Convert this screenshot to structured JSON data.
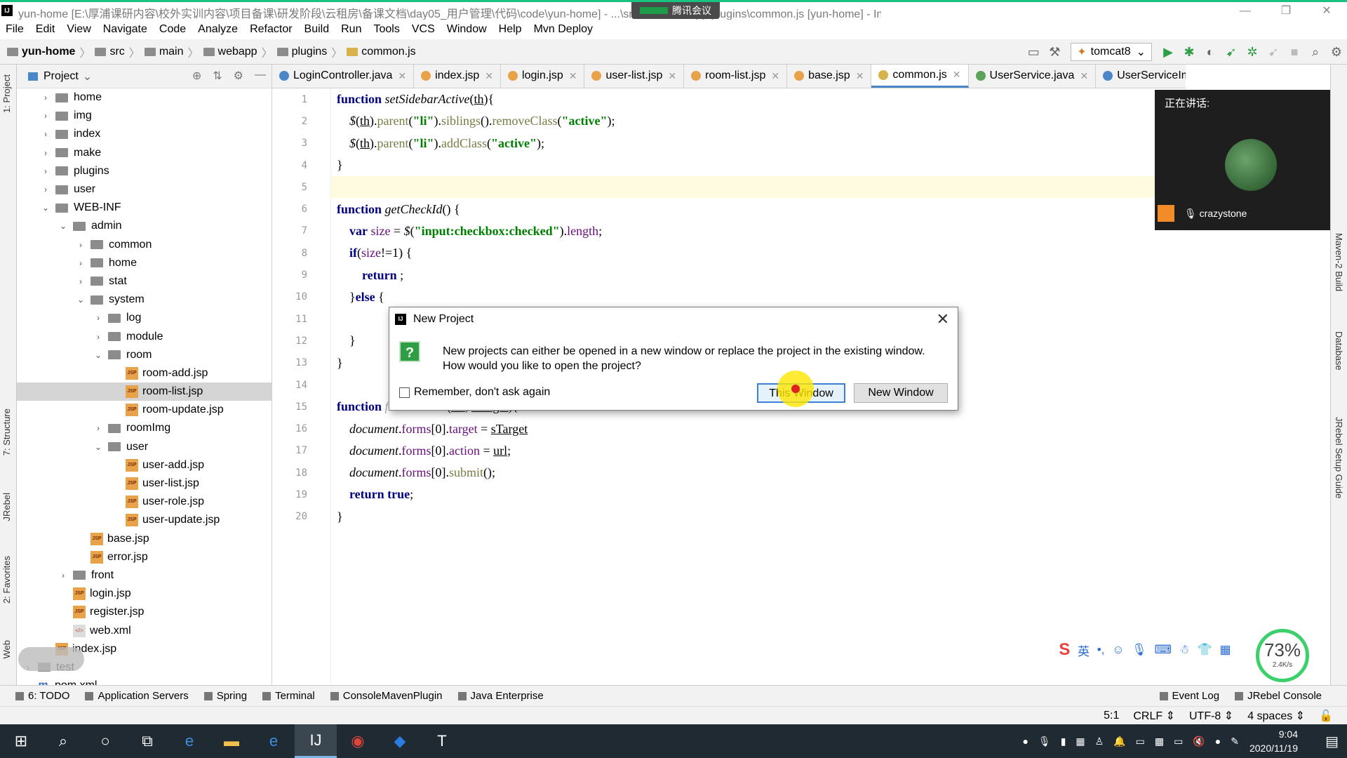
{
  "window": {
    "title": "yun-home [E:\\厚浦课研内容\\校外实训内容\\项目备课\\研发阶段\\云租房\\备课文档\\day05_用户管理\\代码\\code\\yun-home] - ...\\src\\main\\webapp\\plugins\\common.js [yun-home] - IntelliJ IDEA",
    "meeting_label": "腾讯会议"
  },
  "menu": [
    "File",
    "Edit",
    "View",
    "Navigate",
    "Code",
    "Analyze",
    "Refactor",
    "Build",
    "Run",
    "Tools",
    "VCS",
    "Window",
    "Help",
    "Mvn Deploy"
  ],
  "breadcrumb": [
    "yun-home",
    "src",
    "main",
    "webapp",
    "plugins",
    "common.js"
  ],
  "run_config": "tomcat8",
  "project_panel": {
    "title": "Project",
    "tree": [
      {
        "label": "home",
        "type": "folder",
        "depth": 1,
        "arrow": "›"
      },
      {
        "label": "img",
        "type": "folder",
        "depth": 1,
        "arrow": "›"
      },
      {
        "label": "index",
        "type": "folder",
        "depth": 1,
        "arrow": "›"
      },
      {
        "label": "make",
        "type": "folder",
        "depth": 1,
        "arrow": "›"
      },
      {
        "label": "plugins",
        "type": "folder",
        "depth": 1,
        "arrow": "›"
      },
      {
        "label": "user",
        "type": "folder",
        "depth": 1,
        "arrow": "›"
      },
      {
        "label": "WEB-INF",
        "type": "folder",
        "depth": 1,
        "arrow": "⌄"
      },
      {
        "label": "admin",
        "type": "folder",
        "depth": 2,
        "arrow": "⌄"
      },
      {
        "label": "common",
        "type": "folder",
        "depth": 3,
        "arrow": "›"
      },
      {
        "label": "home",
        "type": "folder",
        "depth": 3,
        "arrow": "›"
      },
      {
        "label": "stat",
        "type": "folder",
        "depth": 3,
        "arrow": "›"
      },
      {
        "label": "system",
        "type": "folder",
        "depth": 3,
        "arrow": "⌄"
      },
      {
        "label": "log",
        "type": "folder",
        "depth": 4,
        "arrow": "›"
      },
      {
        "label": "module",
        "type": "folder",
        "depth": 4,
        "arrow": "›"
      },
      {
        "label": "room",
        "type": "folder",
        "depth": 4,
        "arrow": "⌄"
      },
      {
        "label": "room-add.jsp",
        "type": "jsp",
        "depth": 5,
        "arrow": ""
      },
      {
        "label": "room-list.jsp",
        "type": "jsp",
        "depth": 5,
        "arrow": "",
        "selected": true
      },
      {
        "label": "room-update.jsp",
        "type": "jsp",
        "depth": 5,
        "arrow": ""
      },
      {
        "label": "roomImg",
        "type": "folder",
        "depth": 4,
        "arrow": "›"
      },
      {
        "label": "user",
        "type": "folder",
        "depth": 4,
        "arrow": "⌄"
      },
      {
        "label": "user-add.jsp",
        "type": "jsp",
        "depth": 5,
        "arrow": ""
      },
      {
        "label": "user-list.jsp",
        "type": "jsp",
        "depth": 5,
        "arrow": ""
      },
      {
        "label": "user-role.jsp",
        "type": "jsp",
        "depth": 5,
        "arrow": ""
      },
      {
        "label": "user-update.jsp",
        "type": "jsp",
        "depth": 5,
        "arrow": ""
      },
      {
        "label": "base.jsp",
        "type": "jsp",
        "depth": 3,
        "arrow": ""
      },
      {
        "label": "error.jsp",
        "type": "jsp",
        "depth": 3,
        "arrow": ""
      },
      {
        "label": "front",
        "type": "folder",
        "depth": 2,
        "arrow": "›"
      },
      {
        "label": "login.jsp",
        "type": "jsp",
        "depth": 2,
        "arrow": ""
      },
      {
        "label": "register.jsp",
        "type": "jsp",
        "depth": 2,
        "arrow": ""
      },
      {
        "label": "web.xml",
        "type": "xml",
        "depth": 2,
        "arrow": ""
      },
      {
        "label": "index.jsp",
        "type": "jsp",
        "depth": 1,
        "arrow": ""
      },
      {
        "label": "test",
        "type": "folder",
        "depth": 0,
        "arrow": "›"
      },
      {
        "label": "pom.xml",
        "type": "maven",
        "depth": 0,
        "arrow": ""
      }
    ]
  },
  "tabs": [
    {
      "label": "LoginController.java",
      "icon": "class",
      "color": "#4a86c8"
    },
    {
      "label": "index.jsp",
      "icon": "jsp",
      "color": "#e8a24a"
    },
    {
      "label": "login.jsp",
      "icon": "jsp",
      "color": "#e8a24a"
    },
    {
      "label": "user-list.jsp",
      "icon": "jsp",
      "color": "#e8a24a"
    },
    {
      "label": "room-list.jsp",
      "icon": "jsp",
      "color": "#e8a24a"
    },
    {
      "label": "base.jsp",
      "icon": "jsp",
      "color": "#e8a24a"
    },
    {
      "label": "common.js",
      "icon": "js",
      "color": "#d8b24a",
      "active": true
    },
    {
      "label": "UserService.java",
      "icon": "interface",
      "color": "#5aa35a"
    },
    {
      "label": "UserServiceImpl.java",
      "icon": "class",
      "color": "#4a86c8"
    }
  ],
  "code_lines": [
    {
      "n": "1",
      "html": "<span class='kw'>function</span> <span class='fn'>setSidebarActive</span>(<u>th</u>){"
    },
    {
      "n": "2",
      "html": "    <i>$</i>(<u>th</u>).<span class='mth'>parent</span>(<span class='str'>\"li\"</span>).<span class='mth'>siblings</span>().<span class='mth'>removeClass</span>(<span class='str'>\"active\"</span>);"
    },
    {
      "n": "3",
      "html": "    <i>$</i>(<u>th</u>).<span class='mth'>parent</span>(<span class='str'>\"li\"</span>).<span class='mth'>addClass</span>(<span class='str'>\"active\"</span>);"
    },
    {
      "n": "4",
      "html": "}"
    },
    {
      "n": "5",
      "html": "",
      "hl": true
    },
    {
      "n": "6",
      "html": "<span class='kw'>function</span> <span class='fn'>getCheckId</span>() {"
    },
    {
      "n": "7",
      "html": "    <span class='kw'>var</span> <span class='var'>size</span> = <i>$</i>(<span class='str'>\"input:checkbox:checked\"</span>).<span class='var'>length</span>;"
    },
    {
      "n": "8",
      "html": "    <span class='kw'>if</span>(<span class='var'>size</span>!=1) {"
    },
    {
      "n": "9",
      "html": "        <span class='kw'>return</span> ;"
    },
    {
      "n": "10",
      "html": "    }<span class='kw'>else</span> {"
    },
    {
      "n": "11",
      "html": ""
    },
    {
      "n": "12",
      "html": "    }"
    },
    {
      "n": "13",
      "html": "}"
    },
    {
      "n": "14",
      "html": ""
    },
    {
      "n": "15",
      "html": "<span class='kw'>function</span> <span class='fn' style='color:#aaa'>formSubmit</span> (<u>url</u>, <u>sTarget</u>){"
    },
    {
      "n": "16",
      "html": "    <i>document</i>.<span class='var'>forms</span>[0].<span class='var'>target</span> = <u>sTarget</u>"
    },
    {
      "n": "17",
      "html": "    <i>document</i>.<span class='var'>forms</span>[0].<span class='var'>action</span> = <u>url</u>;"
    },
    {
      "n": "18",
      "html": "    <i>document</i>.<span class='var'>forms</span>[0].<span class='mth'>submit</span>();"
    },
    {
      "n": "19",
      "html": "    <span class='kw'>return</span> <span class='kw'>true</span>;"
    },
    {
      "n": "20",
      "html": "}"
    }
  ],
  "speaker_panel": {
    "label": "正在讲话:",
    "name": "crazystone"
  },
  "dialog": {
    "title": "New Project",
    "message_line1": "New projects can either be opened in a new window or replace the project in the existing window.",
    "message_line2": "How would you like to open the project?",
    "checkbox_label": "Remember, don't ask again",
    "btn_this": "This Window",
    "btn_new": "New Window"
  },
  "ime_label": "英",
  "gauge": {
    "percent": "73%",
    "speed": "2.4K/s"
  },
  "left_strip": [
    "1: Project",
    "7: Structure",
    "JRebel",
    "2: Favorites",
    "Web"
  ],
  "right_strip": [
    "Maven-2 Build",
    "Database",
    "JRebel Setup Guide"
  ],
  "bottom_tools": [
    "6: TODO",
    "Application Servers",
    "Spring",
    "Terminal",
    "ConsoleMavenPlugin",
    "Java Enterprise"
  ],
  "bottom_tools_right": [
    "Event Log",
    "JRebel Console"
  ],
  "status": [
    "5:1",
    "CRLF ⇕",
    "UTF-8 ⇕",
    "4 spaces ⇕"
  ],
  "clock": {
    "time": "9:04",
    "date": "2020/11/19"
  }
}
